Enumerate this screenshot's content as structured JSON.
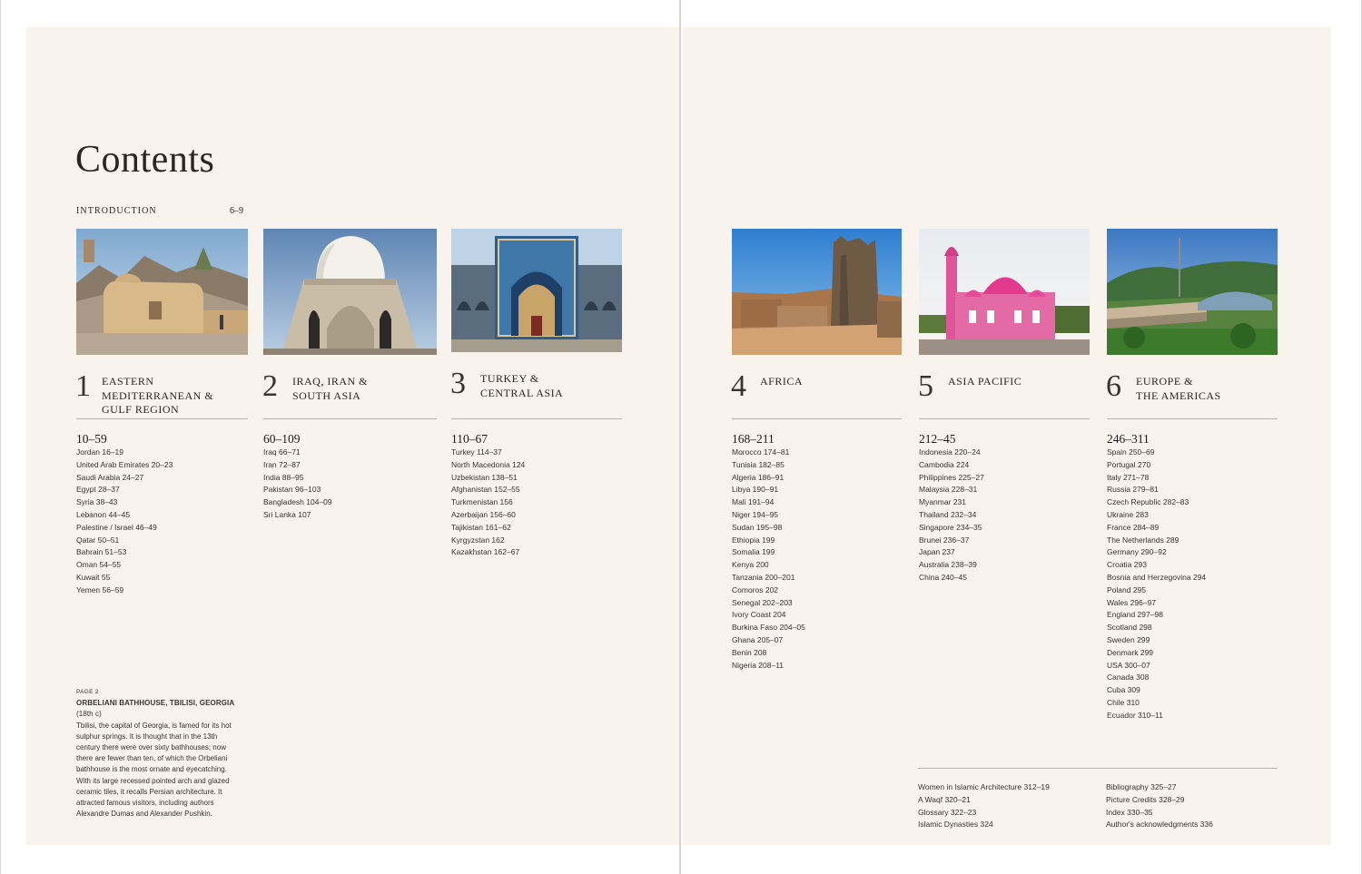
{
  "title": "Contents",
  "introduction": {
    "label": "INTRODUCTION",
    "pages": "6–9"
  },
  "sections": [
    {
      "number": "1",
      "name": "EASTERN\nMEDITERRANEAN &\nGULF REGION",
      "pages": "10–59",
      "photo": "desert-mosque-photo",
      "items": [
        "Jordan 16–19",
        "United Arab Emirates 20–23",
        "Saudi Arabia 24–27",
        "Egypt 28–37",
        "Syria 38–43",
        "Lebanon 44–45",
        "Palestine / Israel 46–49",
        "Qatar 50–51",
        "Bahrain 51–53",
        "Oman 54–55",
        "Kuwait 55",
        "Yemen 56–59"
      ]
    },
    {
      "number": "2",
      "name": "IRAQ, IRAN &\nSOUTH ASIA",
      "pages": "60–109",
      "photo": "white-dome-mausoleum-photo",
      "items": [
        "Iraq 66–71",
        "Iran 72–87",
        "India 88–95",
        "Pakistan 96–103",
        "Bangladesh 104–09",
        "Sri Lanka 107"
      ]
    },
    {
      "number": "3",
      "name": "TURKEY &\nCENTRAL ASIA",
      "pages": "110–67",
      "photo": "tiled-madrasa-photo",
      "items": [
        "Turkey 114–37",
        "North Macedonia 124",
        "Uzbekistan 138–51",
        "Afghanistan 152–55",
        "Turkmenistan 156",
        "Azerbaijan 156–60",
        "Tajikistan 161–62",
        "Kyrgyzstan 162",
        "Kazakhstan 162–67"
      ]
    },
    {
      "number": "4",
      "name": "AFRICA",
      "pages": "168–211",
      "photo": "stone-minaret-photo",
      "items": [
        "Morocco 174–81",
        "Tunisia 182–85",
        "Algeria 186–91",
        "Libya 190–91",
        "Mali 191–94",
        "Niger 194–95",
        "Sudan 195–98",
        "Ethiopia 199",
        "Somalia 199",
        "Kenya 200",
        "Tanzania 200–201",
        "Comoros 202",
        "Senegal 202–203",
        "Ivory Coast 204",
        "Burkina Faso 204–05",
        "Ghana 205–07",
        "Benin 208",
        "Nigeria 208–11"
      ]
    },
    {
      "number": "5",
      "name": "ASIA PACIFIC",
      "pages": "212–45",
      "photo": "pink-mosque-photo",
      "items": [
        "Indonesia 220–24",
        "Cambodia 224",
        "Philippines 225–27",
        "Malaysia 228–31",
        "Myanmar 231",
        "Thailand 232–34",
        "Singapore 234–35",
        "Brunei 236–37",
        "Japan 237",
        "Australia 238–39",
        "China 240–45"
      ]
    },
    {
      "number": "6",
      "name": "EUROPE &\nTHE AMERICAS",
      "pages": "246–311",
      "photo": "modern-mosque-photo",
      "items": [
        "Spain 250–69",
        "Portugal 270",
        "Italy 271–78",
        "Russia 279–81",
        "Czech Republic 282–83",
        "Ukraine 283",
        "France 284–89",
        "The Netherlands 289",
        "Germany 290–92",
        "Croatia 293",
        "Bosnia and Herzegovina 294",
        "Poland 295",
        "Wales 296–97",
        "England 297–98",
        "Scotland 298",
        "Sweden 299",
        "Denmark 299",
        "USA 300–07",
        "Canada 308",
        "Cuba 309",
        "Chile 310",
        "Ecuador 310–11"
      ]
    }
  ],
  "caption": {
    "label": "PAGE 2",
    "title": "ORBELIANI BATHHOUSE, TBILISI, GEORGIA",
    "year": "(18th c)",
    "text": "Tbilisi, the capital of Georgia, is famed for its hot sulphur springs. It is thought that in the 13th century there were over sixty bathhouses; now there are fewer than ten, of which the Orbeliani bathhouse is the most ornate and eyecatching. With its large recessed pointed arch and glazed ceramic tiles, it recalls Persian architecture. It attracted famous visitors, including authors Alexandre Dumas and Alexander Pushkin."
  },
  "back_matter": {
    "col1": [
      "Women in Islamic Architecture 312–19",
      "A Waqf 320–21",
      "Glossary 322–23",
      "Islamic Dynasties 324"
    ],
    "col2": [
      "Bibliography 325–27",
      "Picture Credits 328–29",
      "Index 330–35",
      "Author's acknowledgments 336"
    ]
  },
  "colors": {
    "page": "#f8f3ec",
    "rule": "#b9b2a9",
    "text": "#2b2622"
  }
}
